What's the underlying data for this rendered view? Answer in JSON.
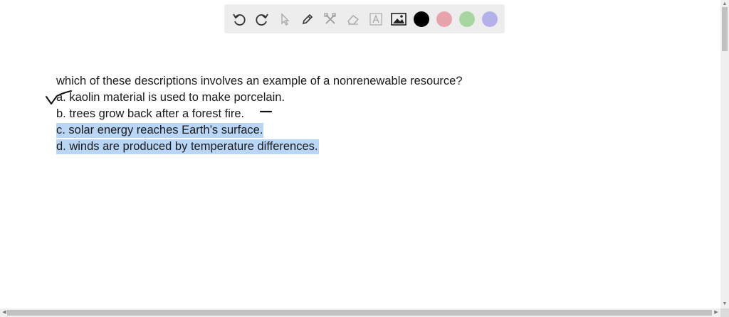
{
  "question": {
    "prompt": "which of these descriptions involves an example of a nonrenewable resource?",
    "options": [
      "a. kaolin material is used to make porcelain.",
      "b. trees grow back after a forest fire.",
      "c. solar energy reaches Earth’s surface.",
      "d. winds are produced by temperature differences."
    ]
  },
  "toolbar": {
    "tools": [
      "undo-icon",
      "redo-icon",
      "pointer-icon",
      "pen-icon",
      "tools-icon",
      "eraser-icon",
      "text-icon",
      "image-icon"
    ],
    "colors": [
      "#000000",
      "#e8a4ad",
      "#a8d5a2",
      "#b6b0ea"
    ]
  },
  "accent": {
    "highlight": "#b9d6f7"
  }
}
